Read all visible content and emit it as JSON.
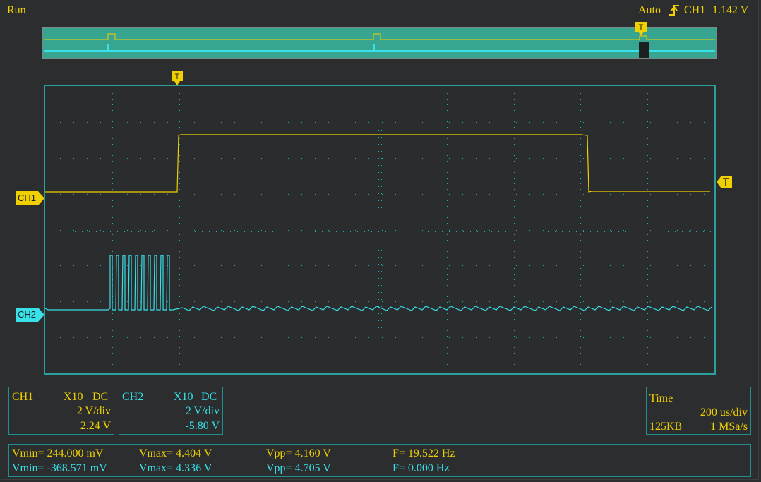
{
  "status": {
    "run_state": "Run"
  },
  "trigger": {
    "mode": "Auto",
    "source": "CH1",
    "level": "1.142 V"
  },
  "markers": {
    "trigger_T": "T",
    "ch1": "CH1",
    "ch2": "CH2"
  },
  "channels": [
    {
      "name": "CH1",
      "probe": "X10",
      "coupling": "DC",
      "scale": "2 V/div",
      "offset": "2.24 V",
      "color": "#f0d000"
    },
    {
      "name": "CH2",
      "probe": "X10",
      "coupling": "DC",
      "scale": "2 V/div",
      "offset": "-5.80 V",
      "color": "#38e0e8"
    }
  ],
  "timebase": {
    "label": "Time",
    "scale": "200 us/div",
    "memory": "125KB",
    "sample_rate": "1 MSa/s"
  },
  "measurements": [
    {
      "vmin": "Vmin= 244.000 mV",
      "vmax": "Vmax= 4.404 V",
      "vpp": "Vpp= 4.160 V",
      "freq": "F= 19.522 Hz"
    },
    {
      "vmin": "Vmin= -368.571 mV",
      "vmax": "Vmax= 4.336 V",
      "vpp": "Vpp= 4.705 V",
      "freq": "F= 0.000 Hz"
    }
  ],
  "colors": {
    "ch1": "#f0d000",
    "ch2": "#38e0e8",
    "grid_border": "#2aa0a0",
    "overview_bg": "#37a58f"
  }
}
